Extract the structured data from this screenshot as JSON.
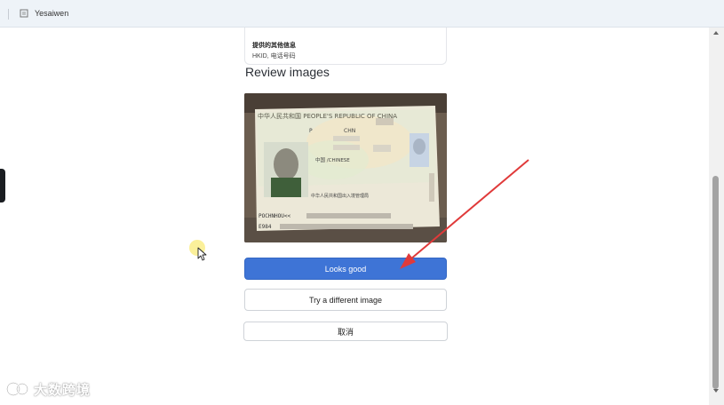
{
  "window": {
    "title": "Yesaiwen",
    "tab_icon": "document-icon"
  },
  "info_card": {
    "label": "提供的其他信息",
    "value": "HKID, 电话号码"
  },
  "review": {
    "heading": "Review images",
    "image_alt": "Passport photo page (People's Republic of China)",
    "passport_header": "中华人民共和国 PEOPLE'S REPUBLIC OF CHINA",
    "passport_type": "P",
    "passport_code": "CHN",
    "passport_nationality": "中国 /CHINESE",
    "passport_authority": "中华人民共和国出入境管理局",
    "passport_mrz_1": "POCHNHOU<<",
    "passport_mrz_2": "E984"
  },
  "buttons": {
    "looks_good": "Looks good",
    "try_different": "Try a different image",
    "cancel": "取消"
  },
  "watermark": {
    "text": "大数跨境"
  },
  "colors": {
    "primary": "#3e74d6",
    "topbar_bg": "#eef3f8",
    "annotation_arrow": "#e03a3a"
  }
}
